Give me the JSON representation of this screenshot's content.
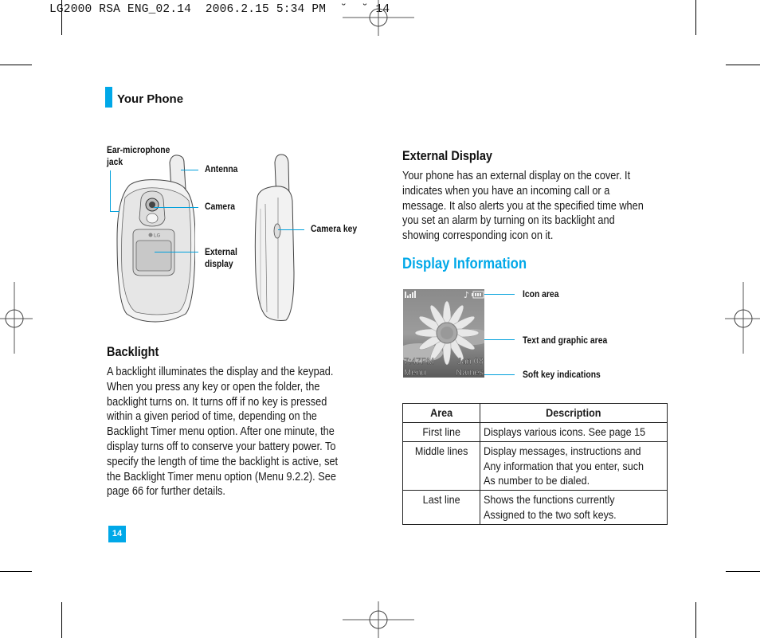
{
  "print_slug": {
    "text": "LG2000 RSA ENG_02.14  2006.2.15 5:34 PM  ˘  ˘ 14"
  },
  "section": {
    "title": "Your Phone",
    "accent_color": "#00a8e8"
  },
  "phone_front": {
    "callouts": {
      "ear_jack": "Ear-microphone jack",
      "ear_jack_line1": "Ear-microphone",
      "ear_jack_line2": "jack",
      "antenna": "Antenna",
      "camera": "Camera",
      "external_display_line1": "External",
      "external_display_line2": "display"
    },
    "logo": "LG"
  },
  "phone_side": {
    "callouts": {
      "camera_key": "Camera key"
    }
  },
  "backlight": {
    "heading": "Backlight",
    "lines": [
      "A backlight illuminates the display and the keypad.",
      "When you press any key or open the folder, the",
      "backlight turns on. It turns off if no key is pressed",
      "within a given period of time, depending on the",
      "Backlight Timer menu option. After one minute, the",
      "display turns off to conserve your battery power. To",
      "specify the length of time the backlight is active, set",
      "the Backlight Timer menu option (Menu 9.2.2). See",
      "page 66 for further details."
    ]
  },
  "external_display": {
    "heading": "External Display",
    "lines": [
      "Your phone has an external display on the cover. It",
      "indicates when you have an incoming call or a",
      "message. It also alerts you at the specified time when",
      "you set an alarm by turning on its backlight and",
      "showing corresponding icon on it."
    ]
  },
  "display_information": {
    "heading": "Display Information",
    "screen": {
      "time": "7:47PM",
      "date": "Jan 08",
      "left_softkey": "Menu",
      "right_softkey": "Names",
      "icons": [
        "signal-icon",
        "music-note-icon",
        "battery-icon"
      ]
    },
    "callouts": {
      "icon_area": "Icon area",
      "text_graphic_area": "Text and graphic area",
      "soft_key_indications": "Soft key indications"
    }
  },
  "table": {
    "headers": [
      "Area",
      "Description"
    ],
    "rows": [
      {
        "area": "First line",
        "description": [
          "Displays various icons. See page 15"
        ]
      },
      {
        "area": "Middle lines",
        "description": [
          "Display messages, instructions and",
          "Any information that you enter, such",
          "As number to be dialed."
        ]
      },
      {
        "area": "Last line",
        "description": [
          "Shows the functions currently",
          "Assigned to the two soft keys."
        ]
      }
    ]
  },
  "page_number": "14"
}
